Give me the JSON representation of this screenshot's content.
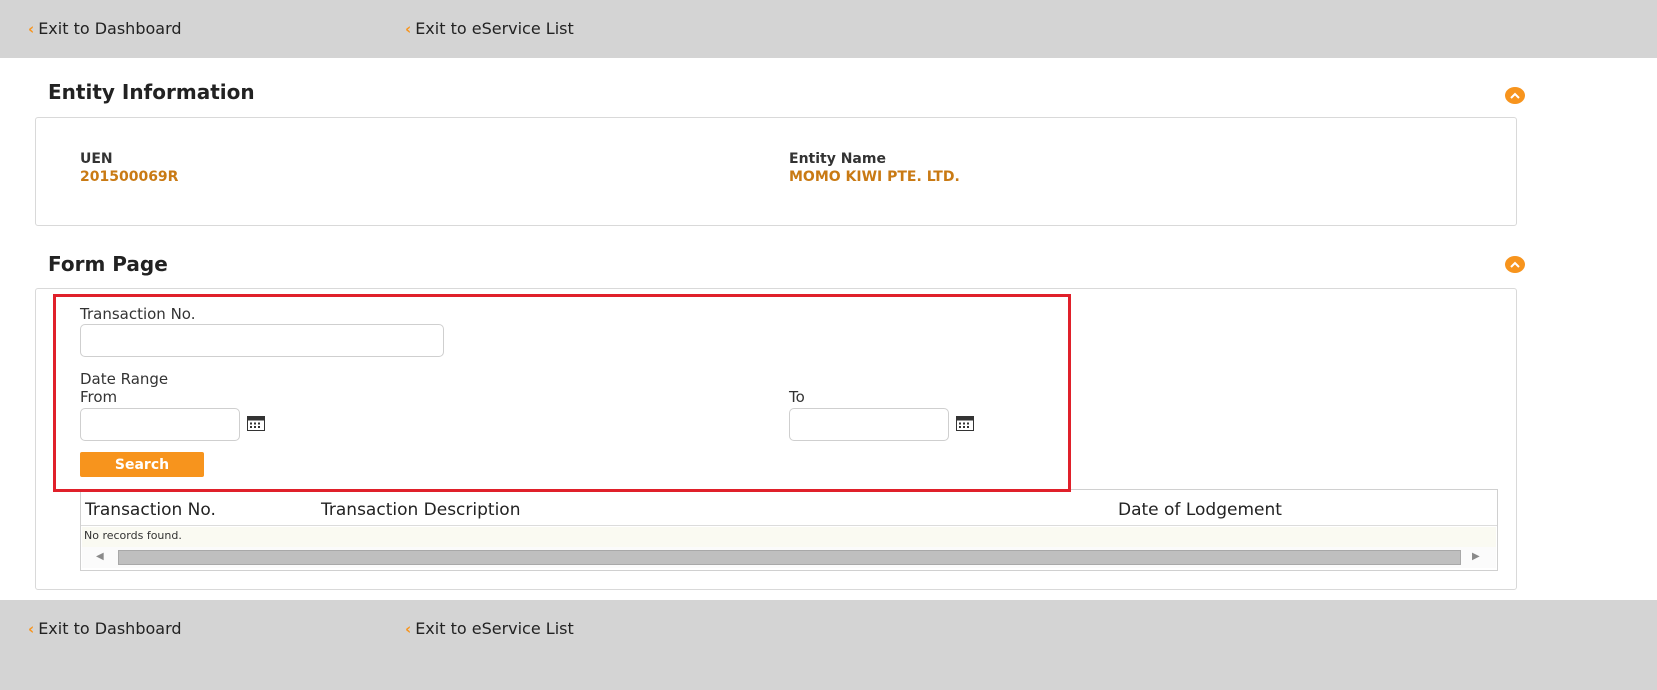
{
  "nav": {
    "exit_dashboard": "Exit to Dashboard",
    "exit_eservice": "Exit to eService List"
  },
  "entity_section": {
    "title": "Entity Information",
    "uen_label": "UEN",
    "uen_value": "201500069R",
    "name_label": "Entity Name",
    "name_value": "MOMO KIWI PTE. LTD."
  },
  "form_section": {
    "title": "Form Page",
    "transaction_no_label": "Transaction No.",
    "transaction_no_value": "",
    "date_range_label": "Date Range",
    "from_label": "From",
    "from_value": "",
    "to_label": "To",
    "to_value": "",
    "search_label": "Search"
  },
  "results_table": {
    "columns": [
      "Transaction No.",
      "Transaction Description",
      "Date of Lodgement"
    ],
    "empty_message": "No records found."
  },
  "icons": {
    "collapse": "chevron-up-icon",
    "calendar": "calendar-icon",
    "back": "chevron-left-icon"
  },
  "colors": {
    "accent": "#f7941d",
    "value_text": "#c97a14",
    "highlight": "#e0202a",
    "nav_bg": "#d4d4d4"
  }
}
